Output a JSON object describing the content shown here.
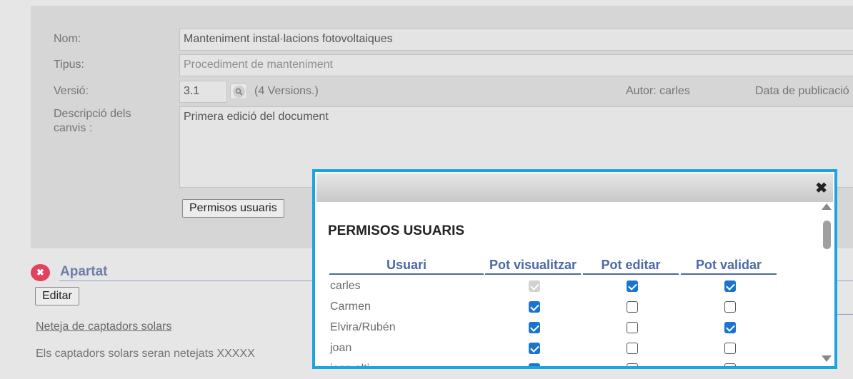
{
  "form": {
    "name_label": "Nom:",
    "name_value": "Manteniment instal·lacions fotovoltaiques",
    "type_label": "Tipus:",
    "type_value": "Procediment de manteniment",
    "version_label": "Versió:",
    "version_value": "3.1",
    "versions_text": "(4 Versions.)",
    "author_text": "Autor: carles",
    "publication_text": "Data de publicació",
    "changes_label": "Descripció dels canvis :",
    "changes_value": "Primera edició del document",
    "permissions_button": "Permisos usuaris"
  },
  "section": {
    "title": "Apartat",
    "edit_button": "Editar",
    "link_text": "Neteja de captadors solars",
    "body_text": "Els captadors solars seran netejats XXXXX"
  },
  "modal": {
    "title": "PERMISOS USUARIS",
    "close_symbol": "✖",
    "columns": [
      "Usuari",
      "Pot visualitzar",
      "Pot editar",
      "Pot validar"
    ],
    "rows": [
      {
        "user": "carles",
        "view": "disabled-checked",
        "edit": true,
        "validate": true
      },
      {
        "user": "Carmen",
        "view": true,
        "edit": false,
        "validate": false
      },
      {
        "user": "Elvira/Rubén",
        "view": true,
        "edit": false,
        "validate": true
      },
      {
        "user": "joan",
        "view": true,
        "edit": false,
        "validate": false
      },
      {
        "user": "joan alti",
        "view": true,
        "edit": false,
        "validate": false
      }
    ]
  },
  "colors": {
    "modal_border": "#1ba4e0",
    "header_blue": "#4b68a8",
    "checkbox_checked": "#1a73cf",
    "delete_red": "#e2425e"
  }
}
